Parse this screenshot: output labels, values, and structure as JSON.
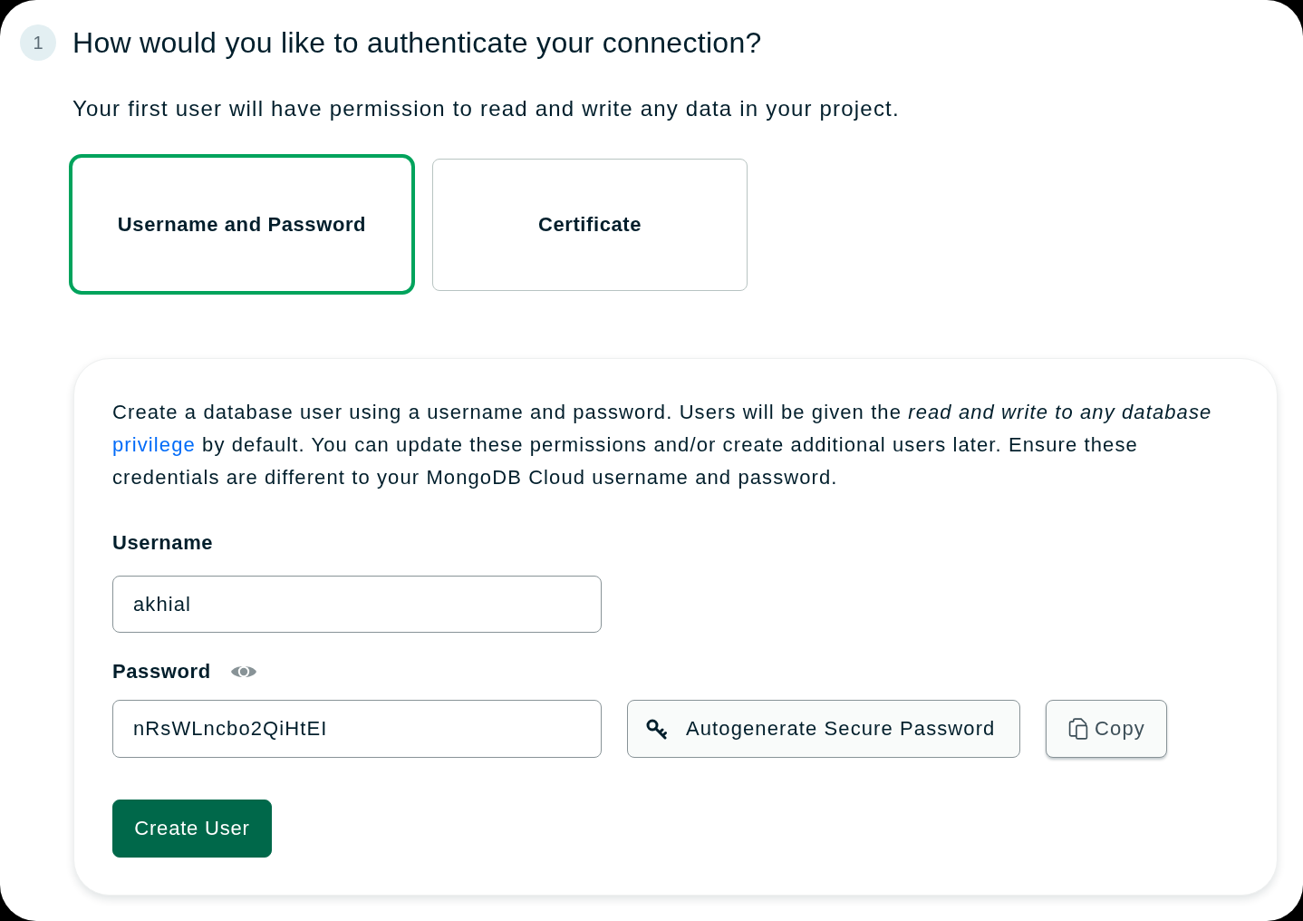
{
  "step": {
    "number": "1",
    "title": "How would you like to authenticate your connection?"
  },
  "subtitle": "Your first user will have permission to read and write any data in your project.",
  "auth_options": [
    {
      "label": "Username and Password",
      "selected": true
    },
    {
      "label": "Certificate",
      "selected": false
    }
  ],
  "form": {
    "description": {
      "text_before": "Create a database user using a username and password. Users will be given the *read and write to any database*",
      "link": "privilege",
      "text_after": "by default. You can update these permissions and/or create additional users later. Ensure these credentials are different to your MongoDB Cloud username and password."
    },
    "username": {
      "label": "Username",
      "value": "akhial"
    },
    "password": {
      "label": "Password",
      "value": "nRsWLncbo2QiHtEI",
      "revealed": true
    },
    "autogenerate_button": "Autogenerate Secure Password",
    "copy_button": "Copy",
    "submit_button": "Create User"
  }
}
